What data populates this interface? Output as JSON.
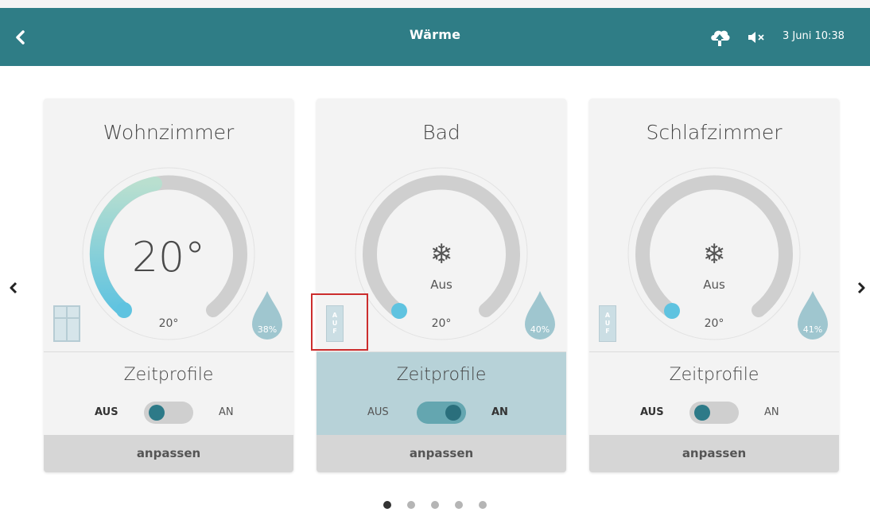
{
  "header": {
    "title": "Wärme",
    "datetime": "3 Juni 10:38",
    "icons": [
      "back-icon",
      "cloud-upload-icon",
      "speaker-mute-icon"
    ],
    "color": "#2f7d86"
  },
  "rooms": [
    {
      "name": "Wohnzimmer",
      "current_temp": "20°",
      "set_temp": "20°",
      "status_label": "",
      "humidity": "38%",
      "indicator": "window-icon",
      "heating_active": true,
      "profile_title": "Zeitprofile",
      "toggle_off_label": "AUS",
      "toggle_on_label": "AN",
      "toggle_state": "AUS",
      "adjust_label": "anpassen"
    },
    {
      "name": "Bad",
      "current_temp": "",
      "set_temp": "20°",
      "status_label": "Aus",
      "humidity": "40%",
      "indicator_letters": [
        "A",
        "U",
        "F"
      ],
      "heating_active": false,
      "profile_title": "Zeitprofile",
      "toggle_off_label": "AUS",
      "toggle_on_label": "AN",
      "toggle_state": "AN",
      "adjust_label": "anpassen"
    },
    {
      "name": "Schlafzimmer",
      "current_temp": "",
      "set_temp": "20°",
      "status_label": "Aus",
      "humidity": "41%",
      "indicator_letters": [
        "A",
        "U",
        "F"
      ],
      "heating_active": false,
      "profile_title": "Zeitprofile",
      "toggle_off_label": "AUS",
      "toggle_on_label": "AN",
      "toggle_state": "AUS",
      "adjust_label": "anpassen"
    }
  ],
  "pagination": {
    "pages": 5,
    "current": 1
  },
  "snowflake": "❄",
  "colors": {
    "accent": "#2f7d86",
    "gauge_active": "#5fc3e0",
    "toggle_on": "#64a6b0"
  }
}
